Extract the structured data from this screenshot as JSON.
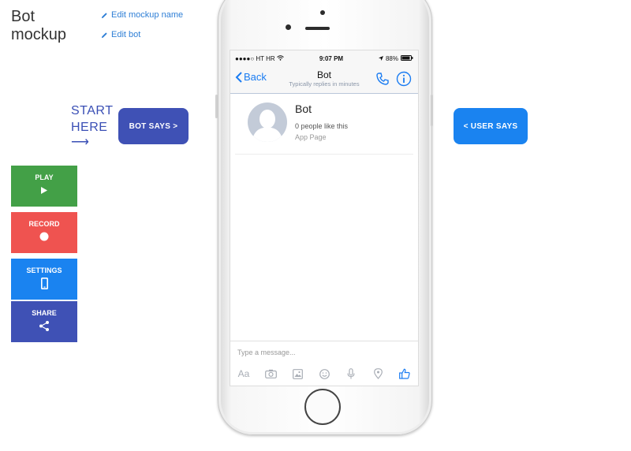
{
  "mockup": {
    "title": "Bot mockup",
    "edit_name_link": "Edit mockup name",
    "edit_bot_link": "Edit bot"
  },
  "start": {
    "label_line1": "START",
    "label_line2": "HERE",
    "arrow": "⟶"
  },
  "flow": {
    "bot_says": "BOT SAYS >",
    "user_says": "< USER SAYS"
  },
  "side_buttons": {
    "play": "PLAY",
    "record": "RECORD",
    "settings": "SETTINGS",
    "share": "SHARE"
  },
  "phone": {
    "status": {
      "carrier": "●●●●○ HT HR",
      "time": "9:07 PM",
      "battery": "88%"
    },
    "nav": {
      "back": "Back",
      "title": "Bot",
      "subtitle": "Typically replies in minutes"
    },
    "profile": {
      "name": "Bot",
      "likes": "0 people like this",
      "type": "App Page"
    },
    "composer": {
      "placeholder": "Type a message...",
      "aa": "Aa"
    }
  },
  "colors": {
    "bot_says": "#3f51b5",
    "user_says": "#1a83f0",
    "play": "#43a047",
    "record": "#ef5350",
    "settings": "#1a83f0",
    "share": "#3f51b5",
    "link": "#2f7fd6"
  }
}
